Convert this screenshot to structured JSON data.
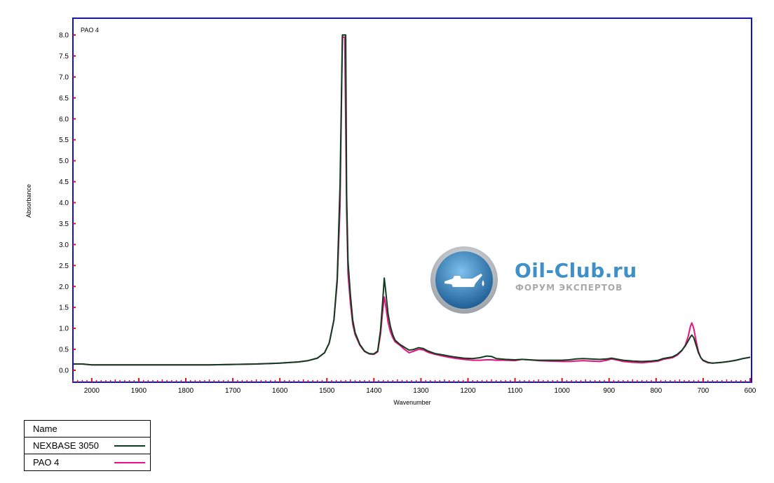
{
  "chart_data": {
    "type": "line",
    "title": "PAO 4",
    "xlabel": "Wavenumber",
    "ylabel": "Absorbance",
    "xlim": [
      2040,
      600
    ],
    "ylim": [
      -0.25,
      8.1
    ],
    "x_reversed": true,
    "x_ticks": [
      2000,
      1900,
      1800,
      1700,
      1600,
      1500,
      1400,
      1300,
      1200,
      1100,
      1000,
      900,
      800,
      700,
      600
    ],
    "y_ticks": [
      0.0,
      0.5,
      1.0,
      1.5,
      2.0,
      2.5,
      3.0,
      3.5,
      4.0,
      4.5,
      5.0,
      5.5,
      6.0,
      6.5,
      7.0,
      7.5,
      8.0
    ],
    "y_tick_labels": [
      "0.0",
      "0.5",
      "1.0",
      "1.5",
      "2.0",
      "2.5",
      "3.0",
      "3.5",
      "4.0",
      "4.5",
      "5.0",
      "5.5",
      "6.0",
      "6.5",
      "7.0",
      "7.5",
      "8.0"
    ],
    "frame_color": "#1010e0",
    "tick_color": "#e01010",
    "series": [
      {
        "name": "NEXBASE 3050",
        "color": "#0f3d1c",
        "points": [
          [
            2040,
            0.15
          ],
          [
            2020,
            0.15
          ],
          [
            2000,
            0.13
          ],
          [
            1950,
            0.13
          ],
          [
            1900,
            0.13
          ],
          [
            1850,
            0.13
          ],
          [
            1800,
            0.13
          ],
          [
            1750,
            0.13
          ],
          [
            1700,
            0.14
          ],
          [
            1650,
            0.15
          ],
          [
            1600,
            0.17
          ],
          [
            1560,
            0.2
          ],
          [
            1540,
            0.23
          ],
          [
            1520,
            0.29
          ],
          [
            1505,
            0.42
          ],
          [
            1495,
            0.65
          ],
          [
            1485,
            1.2
          ],
          [
            1478,
            2.2
          ],
          [
            1472,
            4.4
          ],
          [
            1467,
            8.0
          ],
          [
            1460,
            8.0
          ],
          [
            1458,
            4.2
          ],
          [
            1455,
            2.6
          ],
          [
            1450,
            1.8
          ],
          [
            1445,
            1.2
          ],
          [
            1440,
            0.9
          ],
          [
            1430,
            0.62
          ],
          [
            1420,
            0.46
          ],
          [
            1410,
            0.4
          ],
          [
            1400,
            0.39
          ],
          [
            1392,
            0.46
          ],
          [
            1386,
            0.95
          ],
          [
            1381,
            1.7
          ],
          [
            1378,
            2.2
          ],
          [
            1375,
            1.9
          ],
          [
            1370,
            1.35
          ],
          [
            1365,
            1.05
          ],
          [
            1360,
            0.85
          ],
          [
            1355,
            0.72
          ],
          [
            1345,
            0.62
          ],
          [
            1335,
            0.55
          ],
          [
            1325,
            0.48
          ],
          [
            1315,
            0.5
          ],
          [
            1305,
            0.54
          ],
          [
            1295,
            0.52
          ],
          [
            1285,
            0.46
          ],
          [
            1270,
            0.4
          ],
          [
            1250,
            0.36
          ],
          [
            1230,
            0.32
          ],
          [
            1210,
            0.29
          ],
          [
            1190,
            0.28
          ],
          [
            1175,
            0.3
          ],
          [
            1160,
            0.34
          ],
          [
            1150,
            0.33
          ],
          [
            1140,
            0.28
          ],
          [
            1120,
            0.26
          ],
          [
            1100,
            0.25
          ],
          [
            1085,
            0.26
          ],
          [
            1070,
            0.25
          ],
          [
            1050,
            0.24
          ],
          [
            1030,
            0.24
          ],
          [
            1000,
            0.24
          ],
          [
            985,
            0.25
          ],
          [
            970,
            0.27
          ],
          [
            955,
            0.28
          ],
          [
            940,
            0.27
          ],
          [
            920,
            0.26
          ],
          [
            905,
            0.27
          ],
          [
            895,
            0.29
          ],
          [
            885,
            0.27
          ],
          [
            870,
            0.24
          ],
          [
            850,
            0.22
          ],
          [
            830,
            0.21
          ],
          [
            810,
            0.22
          ],
          [
            795,
            0.24
          ],
          [
            785,
            0.28
          ],
          [
            775,
            0.3
          ],
          [
            765,
            0.32
          ],
          [
            755,
            0.38
          ],
          [
            745,
            0.48
          ],
          [
            738,
            0.58
          ],
          [
            732,
            0.7
          ],
          [
            727,
            0.8
          ],
          [
            724,
            0.84
          ],
          [
            720,
            0.78
          ],
          [
            715,
            0.6
          ],
          [
            710,
            0.42
          ],
          [
            705,
            0.3
          ],
          [
            700,
            0.24
          ],
          [
            690,
            0.19
          ],
          [
            680,
            0.17
          ],
          [
            670,
            0.18
          ],
          [
            660,
            0.19
          ],
          [
            645,
            0.21
          ],
          [
            630,
            0.24
          ],
          [
            615,
            0.28
          ],
          [
            600,
            0.31
          ]
        ]
      },
      {
        "name": "PAO 4",
        "color": "#e8117f",
        "points": [
          [
            2040,
            0.15
          ],
          [
            2020,
            0.15
          ],
          [
            2000,
            0.13
          ],
          [
            1950,
            0.13
          ],
          [
            1900,
            0.13
          ],
          [
            1850,
            0.13
          ],
          [
            1800,
            0.13
          ],
          [
            1750,
            0.13
          ],
          [
            1700,
            0.14
          ],
          [
            1650,
            0.15
          ],
          [
            1600,
            0.17
          ],
          [
            1560,
            0.2
          ],
          [
            1540,
            0.23
          ],
          [
            1520,
            0.29
          ],
          [
            1505,
            0.42
          ],
          [
            1495,
            0.65
          ],
          [
            1485,
            1.2
          ],
          [
            1478,
            2.1
          ],
          [
            1472,
            3.9
          ],
          [
            1467,
            7.95
          ],
          [
            1462,
            7.95
          ],
          [
            1458,
            3.8
          ],
          [
            1455,
            2.3
          ],
          [
            1450,
            1.6
          ],
          [
            1445,
            1.1
          ],
          [
            1440,
            0.85
          ],
          [
            1430,
            0.6
          ],
          [
            1420,
            0.45
          ],
          [
            1410,
            0.39
          ],
          [
            1400,
            0.38
          ],
          [
            1392,
            0.44
          ],
          [
            1386,
            0.85
          ],
          [
            1381,
            1.45
          ],
          [
            1378,
            1.75
          ],
          [
            1375,
            1.55
          ],
          [
            1370,
            1.15
          ],
          [
            1365,
            0.92
          ],
          [
            1360,
            0.78
          ],
          [
            1355,
            0.68
          ],
          [
            1345,
            0.6
          ],
          [
            1335,
            0.5
          ],
          [
            1325,
            0.42
          ],
          [
            1315,
            0.46
          ],
          [
            1305,
            0.5
          ],
          [
            1295,
            0.49
          ],
          [
            1285,
            0.43
          ],
          [
            1270,
            0.38
          ],
          [
            1250,
            0.33
          ],
          [
            1230,
            0.29
          ],
          [
            1210,
            0.26
          ],
          [
            1190,
            0.24
          ],
          [
            1175,
            0.24
          ],
          [
            1160,
            0.25
          ],
          [
            1150,
            0.25
          ],
          [
            1140,
            0.24
          ],
          [
            1120,
            0.24
          ],
          [
            1100,
            0.23
          ],
          [
            1085,
            0.26
          ],
          [
            1070,
            0.25
          ],
          [
            1050,
            0.23
          ],
          [
            1030,
            0.22
          ],
          [
            1000,
            0.21
          ],
          [
            985,
            0.21
          ],
          [
            970,
            0.22
          ],
          [
            955,
            0.23
          ],
          [
            940,
            0.22
          ],
          [
            920,
            0.21
          ],
          [
            905,
            0.24
          ],
          [
            895,
            0.27
          ],
          [
            885,
            0.25
          ],
          [
            870,
            0.21
          ],
          [
            850,
            0.19
          ],
          [
            830,
            0.18
          ],
          [
            810,
            0.2
          ],
          [
            795,
            0.22
          ],
          [
            785,
            0.26
          ],
          [
            775,
            0.28
          ],
          [
            765,
            0.3
          ],
          [
            755,
            0.36
          ],
          [
            745,
            0.47
          ],
          [
            738,
            0.6
          ],
          [
            732,
            0.8
          ],
          [
            727,
            1.05
          ],
          [
            724,
            1.13
          ],
          [
            720,
            1.0
          ],
          [
            715,
            0.7
          ],
          [
            710,
            0.45
          ],
          [
            705,
            0.3
          ],
          [
            700,
            0.23
          ],
          [
            690,
            0.18
          ],
          [
            680,
            0.17
          ],
          [
            670,
            0.18
          ],
          [
            660,
            0.19
          ],
          [
            645,
            0.21
          ],
          [
            630,
            0.24
          ],
          [
            615,
            0.28
          ],
          [
            600,
            0.31
          ]
        ]
      }
    ]
  },
  "legend": {
    "header": "Name",
    "items": [
      {
        "label": "NEXBASE 3050",
        "color": "#0f3d1c"
      },
      {
        "label": "PAO 4",
        "color": "#e8117f"
      }
    ]
  },
  "watermark": {
    "title": "Oil-Club.ru",
    "subtitle": "ФОРУМ ЭКСПЕРТОВ",
    "icon": "oil-can-icon",
    "color": "#3f8fc8"
  }
}
